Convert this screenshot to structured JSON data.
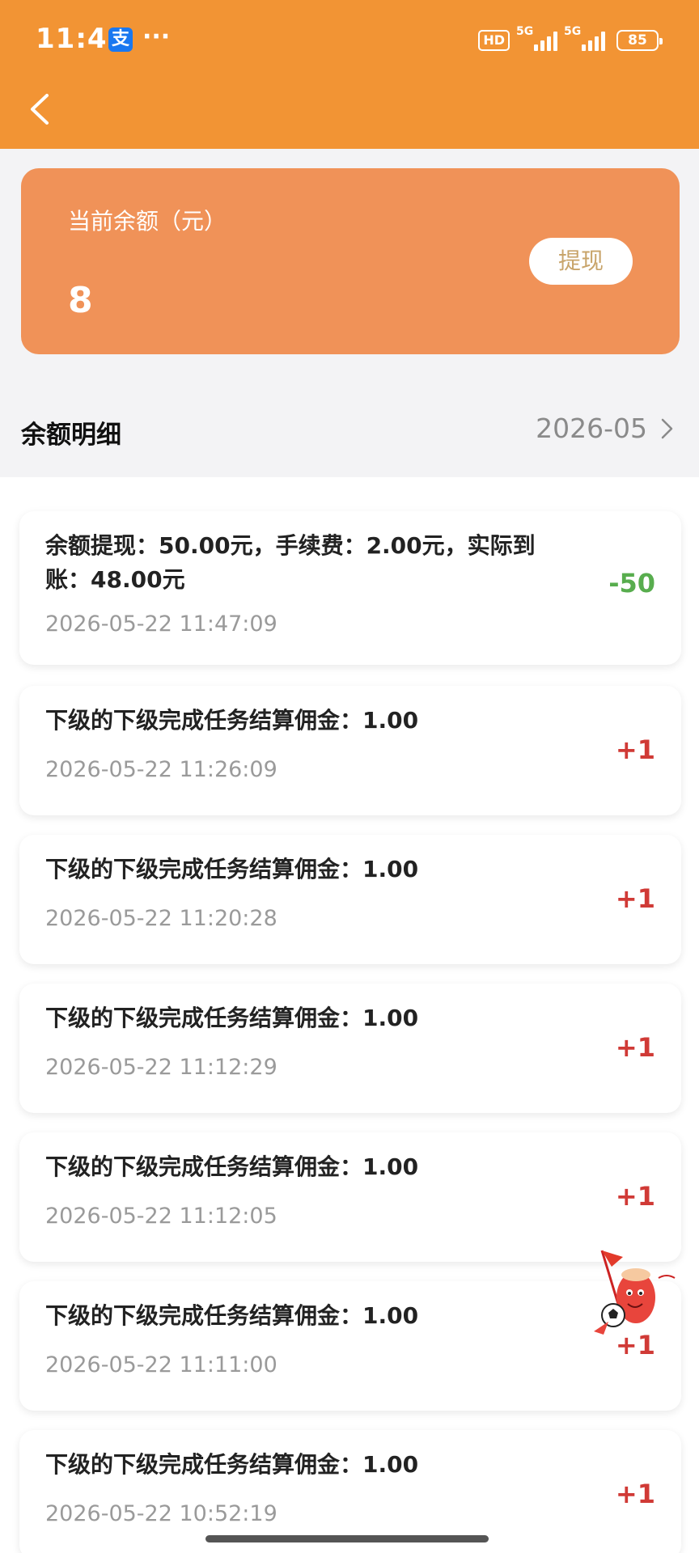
{
  "status_bar": {
    "time": "11:48",
    "app_badge": "支",
    "more": "···",
    "hd": "HD",
    "network1": "5G",
    "network2": "5G",
    "battery": "85"
  },
  "balance": {
    "label": "当前余额（元）",
    "value": "8",
    "withdraw_label": "提现"
  },
  "details": {
    "title": "余额明细",
    "month": "2026-05"
  },
  "records": [
    {
      "desc": "余额提现：50.00元，手续费：2.00元，实际到账：48.00元",
      "time": "2026-05-22 11:47:09",
      "amount": "-50",
      "type": "debit"
    },
    {
      "desc": "下级的下级完成任务结算佣金：1.00",
      "time": "2026-05-22 11:26:09",
      "amount": "+1",
      "type": "credit"
    },
    {
      "desc": "下级的下级完成任务结算佣金：1.00",
      "time": "2026-05-22 11:20:28",
      "amount": "+1",
      "type": "credit"
    },
    {
      "desc": "下级的下级完成任务结算佣金：1.00",
      "time": "2026-05-22 11:12:29",
      "amount": "+1",
      "type": "credit"
    },
    {
      "desc": "下级的下级完成任务结算佣金：1.00",
      "time": "2026-05-22 11:12:05",
      "amount": "+1",
      "type": "credit"
    },
    {
      "desc": "下级的下级完成任务结算佣金：1.00",
      "time": "2026-05-22 11:11:00",
      "amount": "+1",
      "type": "credit"
    },
    {
      "desc": "下级的下级完成任务结算佣金：1.00",
      "time": "2026-05-22 10:52:19",
      "amount": "+1",
      "type": "credit"
    }
  ],
  "colors": {
    "header": "#f29434",
    "card": "#f09258",
    "debit": "#58ad4e",
    "credit": "#d03a36"
  },
  "icons": {
    "back": "chevron-left-icon",
    "month_arrow": "chevron-right-icon",
    "mascot": "mascot-sticker"
  }
}
